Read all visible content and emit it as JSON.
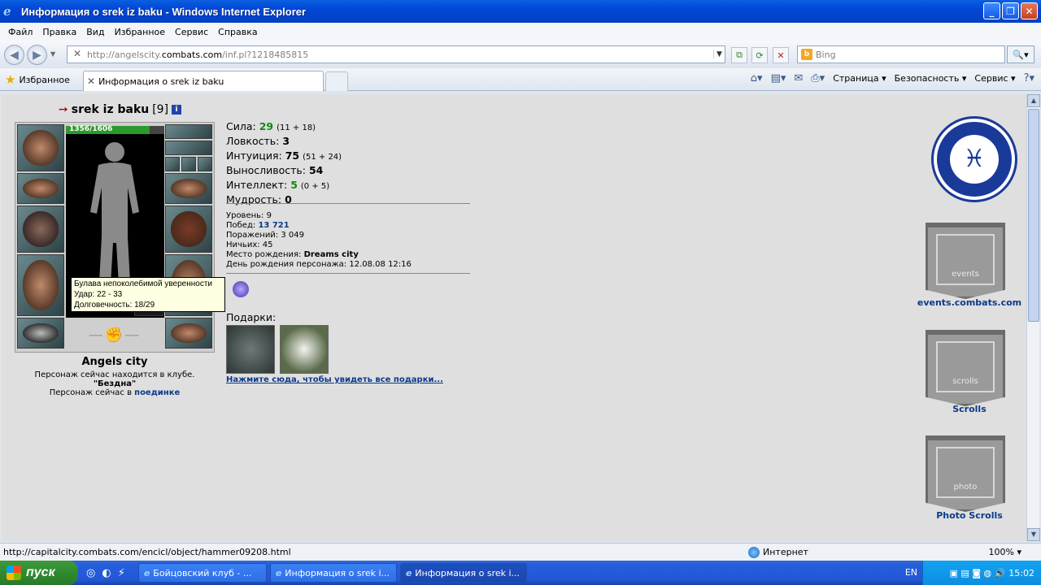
{
  "window": {
    "title": "Информация о srek iz baku - Windows Internet Explorer"
  },
  "menu": [
    "Файл",
    "Правка",
    "Вид",
    "Избранное",
    "Сервис",
    "Справка"
  ],
  "address": {
    "url_prefix": "http://angelscity.",
    "url_domain": "combats.com",
    "url_suffix": "/inf.pl?1218485815"
  },
  "search": {
    "placeholder": "Bing"
  },
  "favorites": {
    "label": "Избранное"
  },
  "tab": {
    "title": "Информация о srek iz baku"
  },
  "command_bar": {
    "page": "Страница",
    "safety": "Безопасность",
    "tools": "Сервис"
  },
  "character": {
    "name": "srek iz baku",
    "level": "[9]",
    "hp": "1356/1606",
    "city": "Angels city",
    "location_line1": "Персонаж сейчас находится в клубе.",
    "location_name": "\"Бездна\"",
    "battle_prefix": "Персонаж сейчас в",
    "battle_link": "поединке"
  },
  "tooltip": {
    "line1": "Булава непоколебимой уверенности",
    "line2": "Удар: 22 - 33",
    "line3": "Долговечность: 18/29"
  },
  "stats": [
    {
      "label": "Сила:",
      "value": "29",
      "extra": "(11 + 18)",
      "green": true
    },
    {
      "label": "Ловкость:",
      "value": "3",
      "extra": "",
      "green": false
    },
    {
      "label": "Интуиция:",
      "value": "75",
      "extra": "(51 + 24)",
      "green": false
    },
    {
      "label": "Выносливость:",
      "value": "54",
      "extra": "",
      "green": false
    },
    {
      "label": "Интеллект:",
      "value": "5",
      "extra": "(0 + 5)",
      "green": true
    },
    {
      "label": "Мудрость:",
      "value": "0",
      "extra": "",
      "green": false
    }
  ],
  "info": {
    "level": "Уровень: 9",
    "wins_label": "Побед:",
    "wins": "13 721",
    "losses": "Поражений: 3 049",
    "draws": "Ничьих: 45",
    "birthplace_label": "Место рождения:",
    "birthplace": "Dreams city",
    "birthday": "День рождения персонажа: 12.08.08 12:16"
  },
  "gifts": {
    "label": "Подарки:",
    "link": "Нажмите сюда, чтобы увидеть все подарки..."
  },
  "right": {
    "events_text": "events",
    "events_caption": "events.combats.com",
    "scrolls_text": "scrolls",
    "scrolls_caption": "Scrolls",
    "photo_text": "photo",
    "photo_caption": "Photo Scrolls"
  },
  "status": {
    "url": "http://capitalcity.combats.com/encicl/object/hammer09208.html",
    "zone": "Интернет",
    "zoom": "100%"
  },
  "taskbar": {
    "start": "пуск",
    "tasks": [
      "Бойцовский клуб - ...",
      "Информация о srek i...",
      "Информация о srek i..."
    ],
    "lang": "EN",
    "clock": "15:02"
  }
}
